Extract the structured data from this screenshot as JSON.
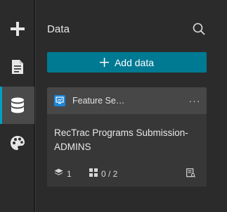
{
  "rail": {
    "items": [
      {
        "name": "add",
        "icon": "plus-icon",
        "active": false
      },
      {
        "name": "page",
        "icon": "document-icon",
        "active": false
      },
      {
        "name": "data",
        "icon": "database-icon",
        "active": true
      },
      {
        "name": "theme",
        "icon": "palette-icon",
        "active": false
      }
    ]
  },
  "panel": {
    "title": "Data",
    "search_icon": "search-icon",
    "add_button_label": "Add data"
  },
  "datasource": {
    "type_label": "Feature Se…",
    "type_icon": "feature-service-icon",
    "more_icon": "more-icon",
    "more_label": "···",
    "name": "RecTrac Programs Submission-ADMINS",
    "layers_count": "1",
    "widgets_used": "0 / 2"
  },
  "colors": {
    "accent": "#00a0c6",
    "button": "#007a93",
    "rail_bg": "#2b2b2b",
    "panel_bg": "#2b2b2b",
    "card_bg": "#373737",
    "card_header_bg": "#474747",
    "type_icon_bg": "#1a86d8"
  }
}
